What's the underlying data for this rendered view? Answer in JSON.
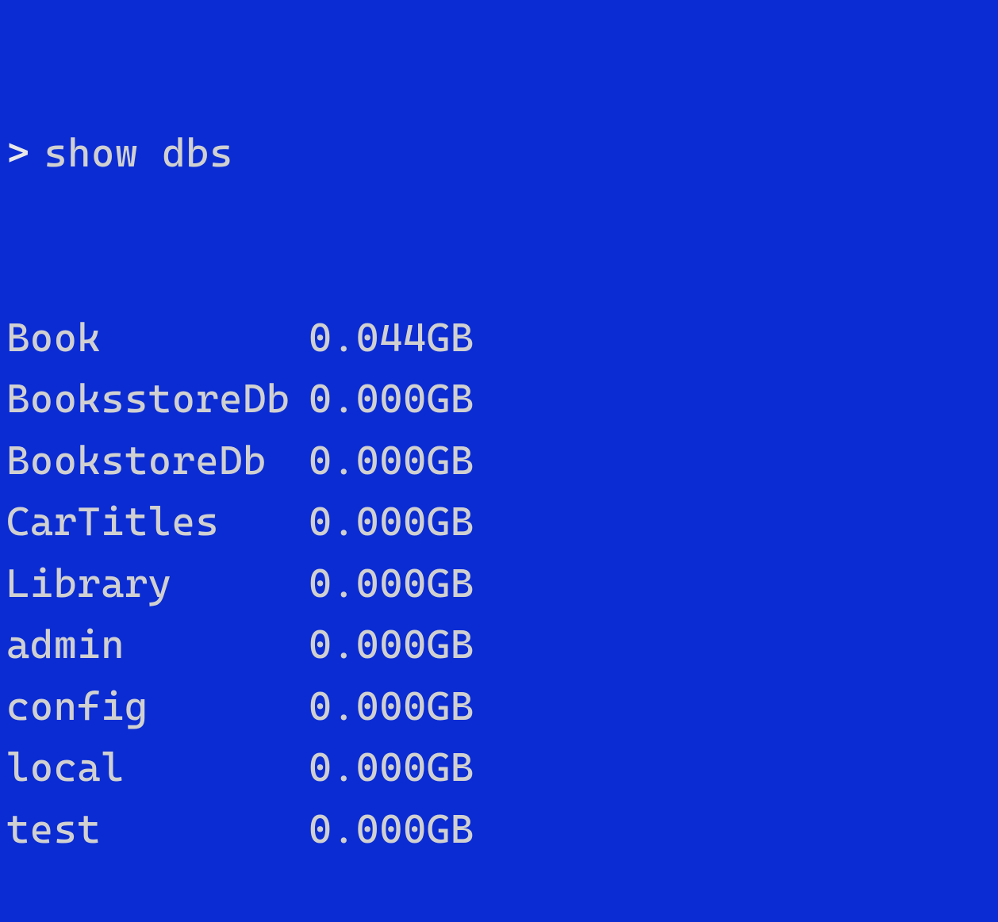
{
  "prompt": {
    "symbol": ">",
    "command": "show dbs"
  },
  "databases": [
    {
      "name": "Book",
      "size": "0.044GB"
    },
    {
      "name": "BooksstoreDb",
      "size": "0.000GB"
    },
    {
      "name": "BookstoreDb",
      "size": "0.000GB"
    },
    {
      "name": "CarTitles",
      "size": "0.000GB"
    },
    {
      "name": "Library",
      "size": "0.000GB"
    },
    {
      "name": "admin",
      "size": "0.000GB"
    },
    {
      "name": "config",
      "size": "0.000GB"
    },
    {
      "name": "local",
      "size": "0.000GB"
    },
    {
      "name": "test",
      "size": "0.000GB"
    }
  ]
}
